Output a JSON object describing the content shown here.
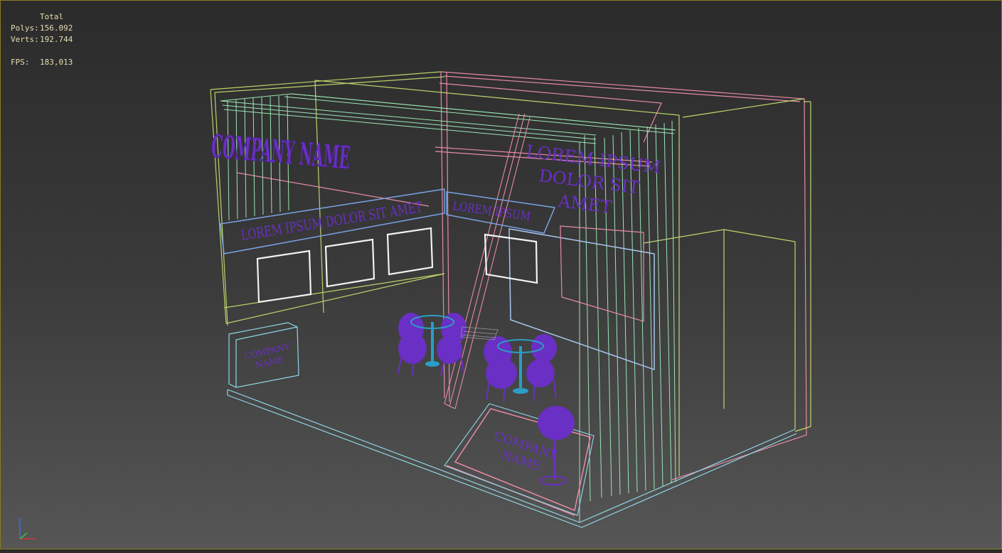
{
  "stats": {
    "total_label": "Total",
    "polys_label": "Polys:",
    "polys_value": "156.092",
    "verts_label": "Verts:",
    "verts_value": "192.744",
    "fps_label": "FPS:",
    "fps_value": "183,013"
  },
  "scene": {
    "company_name_main": "COMPANY NAME",
    "banner_left": "LOREM IPSUM DOLOR SIT AMET",
    "banner_right": "LOREM IPSUM",
    "side_text_line1": "LOREM IPSUM",
    "side_text_line2": "DOLOR SIT",
    "side_text_line3": "AMET",
    "counter_left_line1": "COMPANY",
    "counter_left_line2": "NAME",
    "counter_front_line1": "COMPANY",
    "counter_front_line2": "NAME"
  },
  "axis": {
    "z_label": "z"
  },
  "colors": {
    "wire_green": "#9ae6b4",
    "wire_pink": "#e88aa6",
    "wire_yellow": "#b9d36a",
    "wire_cyan": "#8fd6e6",
    "wire_blue": "#7aa3e6",
    "purple": "#6a2fc4",
    "teal": "#2a9ec4",
    "stats_text": "#e6dcb4"
  }
}
